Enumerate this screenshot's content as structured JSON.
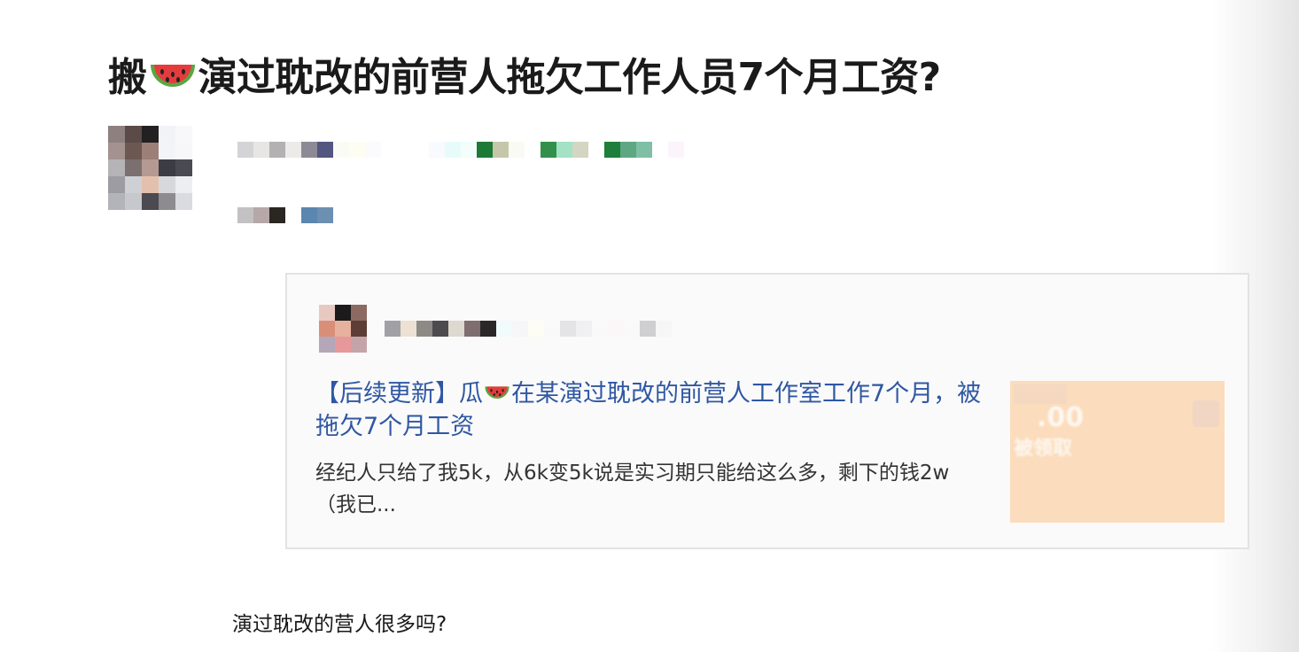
{
  "article": {
    "title_before_emoji": "搬",
    "title_emoji": "watermelon-emoji",
    "title_after_emoji": "演过耽改的前营人拖欠工作人员7个月工资?",
    "body_paragraph": "演过耽改的营人很多吗?"
  },
  "author": {
    "avatar_pixelated": true,
    "name_pixelated": true,
    "meta_pixelated": true
  },
  "link_card": {
    "title_before_emoji": "【后续更新】瓜",
    "title_emoji": "watermelon-emoji",
    "title_after_emoji": "在某演过耽改的前营人工作室工作7个月，被拖欠7个月工资",
    "excerpt": "经纪人只给了我5k，从6k变5k说是实习期只能给这么多，剩下的钱2w（我已...",
    "thumbnail": {
      "amount_text": ".00",
      "label_text": "被领取"
    }
  },
  "colors": {
    "title": "#1a1a1a",
    "link": "#2f57a3",
    "card_background": "#fafafa",
    "card_border": "#e3e3e3",
    "thumbnail": "#fbdcbc"
  }
}
